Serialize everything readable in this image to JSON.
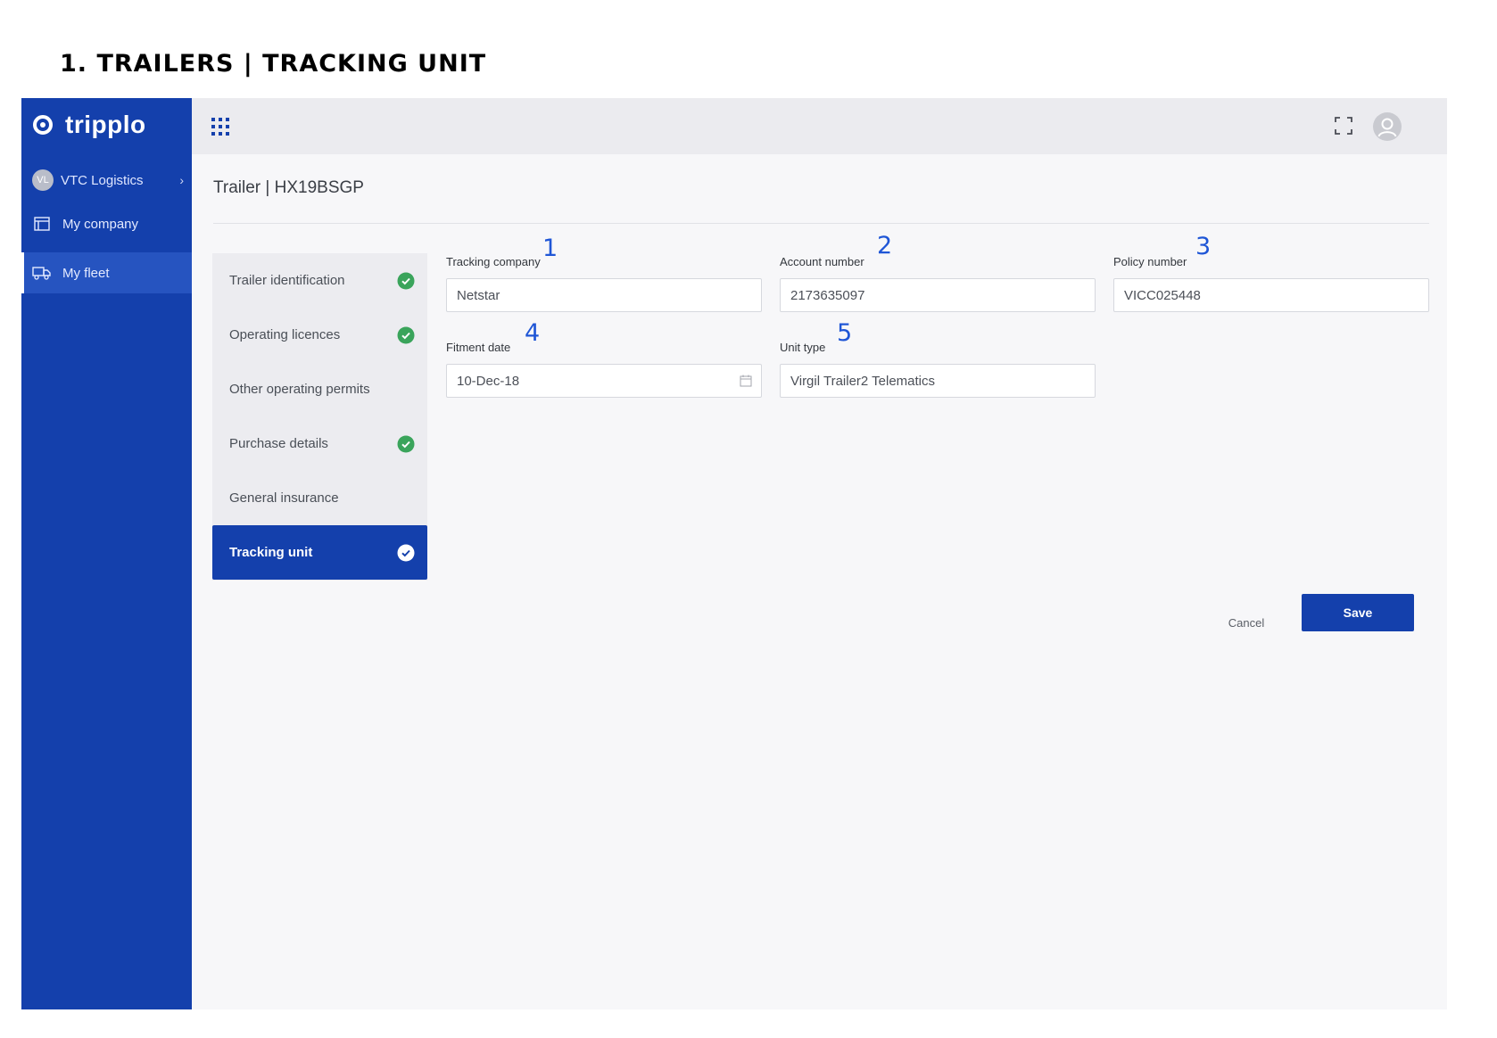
{
  "doc_heading": "1.  TRAILERS | TRACKING UNIT",
  "sidebar": {
    "logo": "tripplo",
    "company": {
      "avatar": "VL",
      "name": "VTC Logistics"
    },
    "items": [
      {
        "label": "My company",
        "icon": "building-icon"
      },
      {
        "label": "My fleet",
        "icon": "truck-icon",
        "active": true
      }
    ]
  },
  "topbar": {
    "icons": [
      "apps-grid-icon",
      "fullscreen-icon",
      "user-avatar-icon"
    ]
  },
  "page": {
    "title": "Trailer | HX19BSGP"
  },
  "steps": [
    {
      "label": "Trailer identification",
      "complete": true
    },
    {
      "label": "Operating licences",
      "complete": true
    },
    {
      "label": "Other operating permits",
      "complete": false
    },
    {
      "label": "Purchase details",
      "complete": true
    },
    {
      "label": "General insurance",
      "complete": false
    },
    {
      "label": "Tracking unit",
      "complete": true,
      "active": true
    }
  ],
  "form": {
    "tracking_company": {
      "label": "Tracking company",
      "value": "Netstar",
      "marker": "1"
    },
    "account_number": {
      "label": "Account number",
      "value": "2173635097",
      "marker": "2"
    },
    "policy_number": {
      "label": "Policy number",
      "value": "VICC025448",
      "marker": "3"
    },
    "fitment_date": {
      "label": "Fitment date",
      "value": "10-Dec-18",
      "marker": "4"
    },
    "unit_type": {
      "label": "Unit type",
      "value": "Virgil Trailer2 Telematics",
      "marker": "5"
    }
  },
  "actions": {
    "cancel": "Cancel",
    "save": "Save"
  },
  "colors": {
    "primary": "#1440ac",
    "success": "#3aa45b",
    "marker": "#1f56d6"
  }
}
